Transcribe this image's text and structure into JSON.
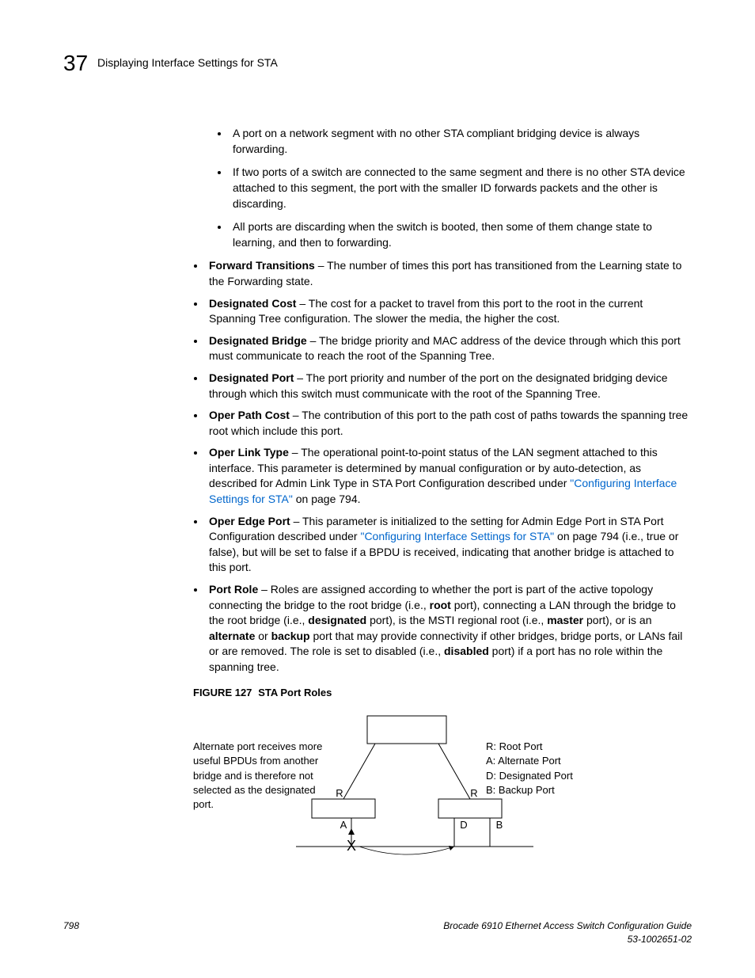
{
  "header": {
    "chapter_number": "37",
    "title": "Displaying Interface Settings for STA"
  },
  "inner_bullets": [
    "A port on a network segment with no other STA compliant bridging device is always forwarding.",
    "If two ports of a switch are connected to the same segment and there is no other STA device attached to this segment, the port with the smaller ID forwards packets and the other is discarding.",
    "All ports are discarding when the switch is booted, then some of them change state to learning, and then to forwarding."
  ],
  "items": {
    "forward_transitions": {
      "term": "Forward Transitions",
      "text": " – The number of times this port has transitioned from the Learning state to the Forwarding state."
    },
    "designated_cost": {
      "term": "Designated Cost",
      "text": " – The cost for a packet to travel from this port to the root in the current Spanning Tree configuration. The slower the media, the higher the cost."
    },
    "designated_bridge": {
      "term": "Designated Bridge",
      "text": " – The bridge priority and MAC address of the device through which this port must communicate to reach the root of the Spanning Tree."
    },
    "designated_port": {
      "term": "Designated Port",
      "text": " – The port priority and number of the port on the designated bridging device through which this switch must communicate with the root of the Spanning Tree."
    },
    "oper_path_cost": {
      "term": "Oper Path Cost",
      "text": " – The contribution of this port to the path cost of paths towards the spanning tree root which include this port."
    },
    "oper_link_type": {
      "term": "Oper Link Type",
      "text_before": " – The operational point-to-point status of the LAN segment attached to this interface. This parameter is determined by manual configuration or by auto-detection, as described for Admin Link Type in STA Port Configuration described under ",
      "link": "\"Configuring Interface Settings for STA\"",
      "text_after": " on page 794."
    },
    "oper_edge_port": {
      "term": "Oper Edge Port",
      "text_before": " – This parameter is initialized to the setting for Admin Edge Port in STA Port Configuration described under ",
      "link": "\"Configuring Interface Settings for STA\"",
      "text_after": " on page 794 (i.e., true or false), but will be set to false if a BPDU is received, indicating that another bridge is attached to this port."
    },
    "port_role": {
      "term": "Port Role",
      "t1": " – Roles are assigned according to whether the port is part of the active topology connecting the bridge to the root bridge (i.e., ",
      "b1": "root",
      "t2": " port), connecting a LAN through the bridge to the root bridge (i.e., ",
      "b2": "designated",
      "t3": " port), is the MSTI regional root (i.e., ",
      "b3": "master",
      "t4": " port), or is an ",
      "b4": "alternate",
      "t5": " or ",
      "b5": "backup",
      "t6": " port that may provide connectivity if other bridges, bridge ports, or LANs fail or are removed. The role is set to disabled (i.e., ",
      "b6": "disabled",
      "t7": " port) if a port has no role within the spanning tree."
    }
  },
  "figure": {
    "num": "FIGURE 127",
    "title": "STA Port Roles",
    "left_caption": "Alternate port receives more useful BPDUs from another bridge and is therefore not selected as the designated port.",
    "legend": {
      "r": "R: Root Port",
      "a": "A: Alternate Port",
      "d": "D: Designated Port",
      "b": "B: Backup Port"
    },
    "labels": {
      "r": "R",
      "a": "A",
      "d": "D",
      "b": "B"
    }
  },
  "footer": {
    "page_num": "798",
    "doc_title": "Brocade 6910 Ethernet Access Switch Configuration Guide",
    "doc_id": "53-1002651-02"
  }
}
